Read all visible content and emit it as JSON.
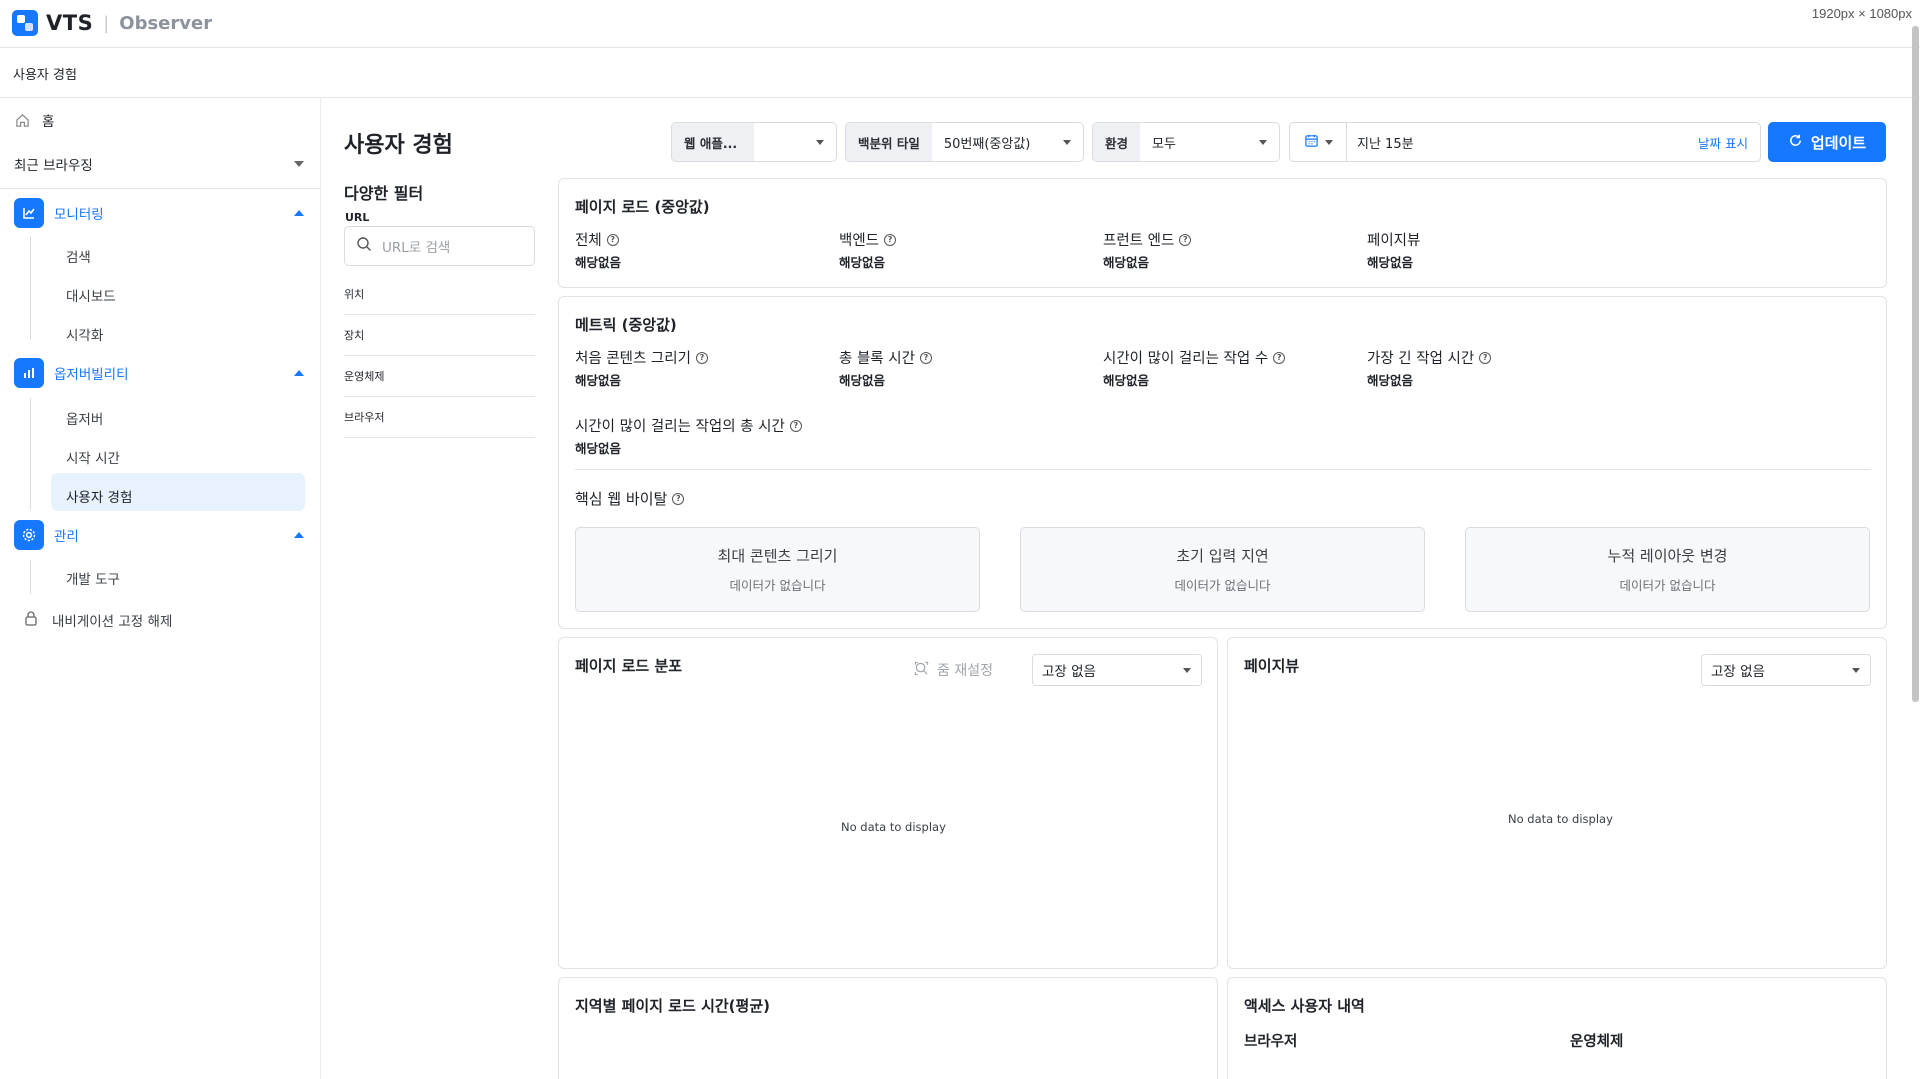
{
  "app": {
    "brand": "VTS",
    "product": "Observer",
    "dims_label": "1920px × 1080px"
  },
  "breadcrumb": "사용자 경험",
  "sidebar": {
    "home": "홈",
    "recent": "최근 브라우징",
    "groups": [
      {
        "label": "모니터링",
        "items": [
          "검색",
          "대시보드",
          "시각화"
        ]
      },
      {
        "label": "옵저버빌리티",
        "items": [
          "옵저버",
          "시작 시간",
          "사용자 경험"
        ]
      },
      {
        "label": "관리",
        "items": [
          "개발 도구"
        ]
      }
    ],
    "unpin": "내비게이션 고정 해제"
  },
  "page": {
    "title": "사용자 경험"
  },
  "filters": {
    "title": "다양한 필터",
    "url_label": "URL",
    "url_placeholder": "URL로 검색",
    "items": [
      "위치",
      "장치",
      "운영체제",
      "브라우저"
    ]
  },
  "toolbar": {
    "app_label": "웹 애플...",
    "app_value": "",
    "percentile_label": "백분위 타일",
    "percentile_value": "50번째(중앙값)",
    "env_label": "환경",
    "env_value": "모두",
    "time_value": "지난 15분",
    "show_date": "날짜 표시",
    "update": "업데이트"
  },
  "page_load": {
    "title": "페이지 로드 (중앙값)",
    "metrics": [
      {
        "name": "전체",
        "value": "해당없음",
        "help": true
      },
      {
        "name": "백엔드",
        "value": "해당없음",
        "help": true
      },
      {
        "name": "프런트 엔드",
        "value": "해당없음",
        "help": true
      },
      {
        "name": "페이지뷰",
        "value": "해당없음",
        "help": false
      }
    ]
  },
  "metrics": {
    "title": "메트릭 (중앙값)",
    "items": [
      {
        "name": "처음 콘텐츠 그리기",
        "value": "해당없음"
      },
      {
        "name": "총 블록 시간",
        "value": "해당없음"
      },
      {
        "name": "시간이 많이 걸리는 작업 수",
        "value": "해당없음"
      },
      {
        "name": "가장 긴 작업 시간",
        "value": "해당없음"
      },
      {
        "name": "시간이 많이 걸리는 작업의 총 시간",
        "value": "해당없음"
      }
    ],
    "cwv_title": "핵심 웹 바이탈",
    "cwv_cards": [
      {
        "name": "최대 콘텐츠 그리기",
        "desc": "데이터가 없습니다"
      },
      {
        "name": "초기 입력 지연",
        "desc": "데이터가 없습니다"
      },
      {
        "name": "누적 레이아웃 변경",
        "desc": "데이터가 없습니다"
      }
    ]
  },
  "dist_panel": {
    "title": "페이지 로드 분포",
    "zoom_reset": "줌 재설정",
    "select": "고장 없음",
    "nodata": "No data to display"
  },
  "pageview_panel": {
    "title": "페이지뷰",
    "select": "고장 없음",
    "nodata": "No data to display"
  },
  "region_panel": {
    "title": "지역별 페이지 로드 시간(평균)"
  },
  "access_panel": {
    "title": "액세스 사용자 내역",
    "col1": "브라우저",
    "col2": "운영체제"
  },
  "colors": {
    "accent": "#1677ff",
    "active_bg": "#e8f1fe"
  },
  "icons": [
    "home-icon",
    "monitoring-icon",
    "observability-icon",
    "settings-icon",
    "lock-icon",
    "search-icon",
    "calendar-icon",
    "refresh-icon",
    "help-icon",
    "zoom-reset-icon"
  ]
}
